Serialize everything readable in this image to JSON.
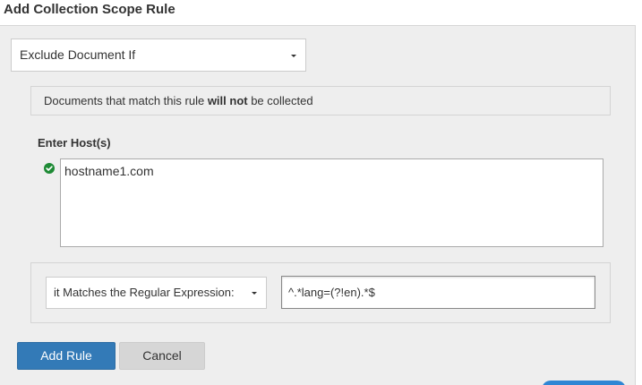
{
  "dialog": {
    "title": "Add Collection Scope Rule"
  },
  "rule_type": {
    "selected": "Exclude Document If",
    "icon": "caret-down-icon"
  },
  "info": {
    "text_before": "Documents that match this rule ",
    "text_bold": "will not",
    "text_after": " be collected"
  },
  "hosts": {
    "label": "Enter Host(s)",
    "value": "hostname1.com",
    "status_icon": "check-circle-icon",
    "status_color": "#1e8a35"
  },
  "condition": {
    "selected": "it Matches the Regular Expression:",
    "icon": "caret-down-icon",
    "regex_value": "^.*lang=(?!en).*$"
  },
  "actions": {
    "add_label": "Add Rule",
    "cancel_label": "Cancel"
  },
  "colors": {
    "primary": "#337ab7",
    "panel_bg": "#eeeeee",
    "cancel_bg": "#d6d6d6"
  }
}
